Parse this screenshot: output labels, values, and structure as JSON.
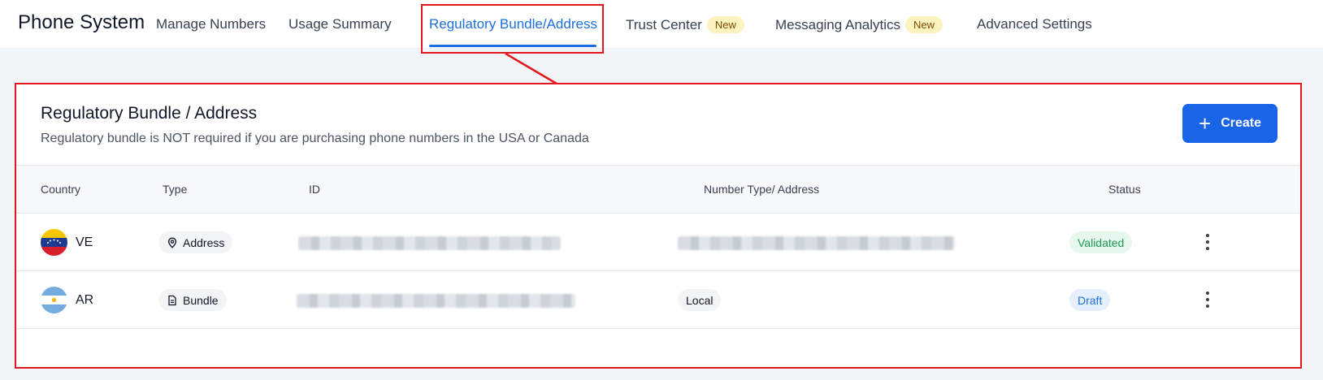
{
  "app": {
    "title": "Phone System"
  },
  "tabs": [
    {
      "label": "Manage Numbers"
    },
    {
      "label": "Usage Summary"
    },
    {
      "label": "Regulatory Bundle/Address",
      "active": true
    },
    {
      "label": "Trust Center",
      "badge": "New"
    },
    {
      "label": "Messaging Analytics",
      "badge": "New"
    },
    {
      "label": "Advanced Settings"
    }
  ],
  "section": {
    "title": "Regulatory Bundle / Address",
    "subtitle": "Regulatory bundle is NOT required if you are purchasing phone numbers in the USA or Canada",
    "create_label": "Create"
  },
  "table": {
    "columns": [
      "Country",
      "Type",
      "ID",
      "Number Type/ Address",
      "Status"
    ],
    "rows": [
      {
        "country": "VE",
        "flag_icon": "venezuela-flag-icon",
        "type": "Address",
        "type_icon": "map-pin-icon",
        "id_redacted": true,
        "number_type_redacted": true,
        "status": "Validated"
      },
      {
        "country": "AR",
        "flag_icon": "argentina-flag-icon",
        "type": "Bundle",
        "type_icon": "document-icon",
        "id_redacted": true,
        "number_type": "Local",
        "status": "Draft"
      }
    ]
  },
  "colors": {
    "accent": "#1d6fe0",
    "primary_button": "#1a64e8",
    "highlight_outline": "#e3171e",
    "badge_new_bg": "#fdf3bf",
    "validated": "#1a9a52",
    "draft": "#1d6fe0"
  }
}
